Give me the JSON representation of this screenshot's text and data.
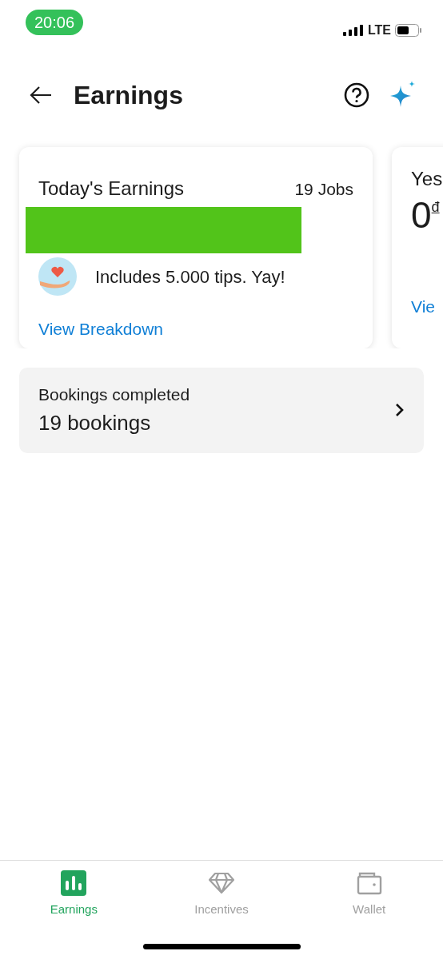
{
  "status_bar": {
    "time": "20:06",
    "network": "LTE"
  },
  "header": {
    "title": "Earnings"
  },
  "cards": [
    {
      "title": "Today's Earnings",
      "count": "19 Jobs",
      "redacted": true,
      "tip_text": "Includes 5.000 tips. Yay!",
      "link": "View Breakdown"
    },
    {
      "title": "Yes",
      "amount": "0",
      "currency": "đ",
      "link": "Vie"
    }
  ],
  "summary": {
    "label": "Bookings completed",
    "value": "19 bookings"
  },
  "tabs": [
    {
      "label": "Earnings",
      "kind": "chart",
      "selected": true
    },
    {
      "label": "Incentives",
      "kind": "diamond",
      "selected": false
    },
    {
      "label": "Wallet",
      "kind": "wallet",
      "selected": false
    }
  ]
}
